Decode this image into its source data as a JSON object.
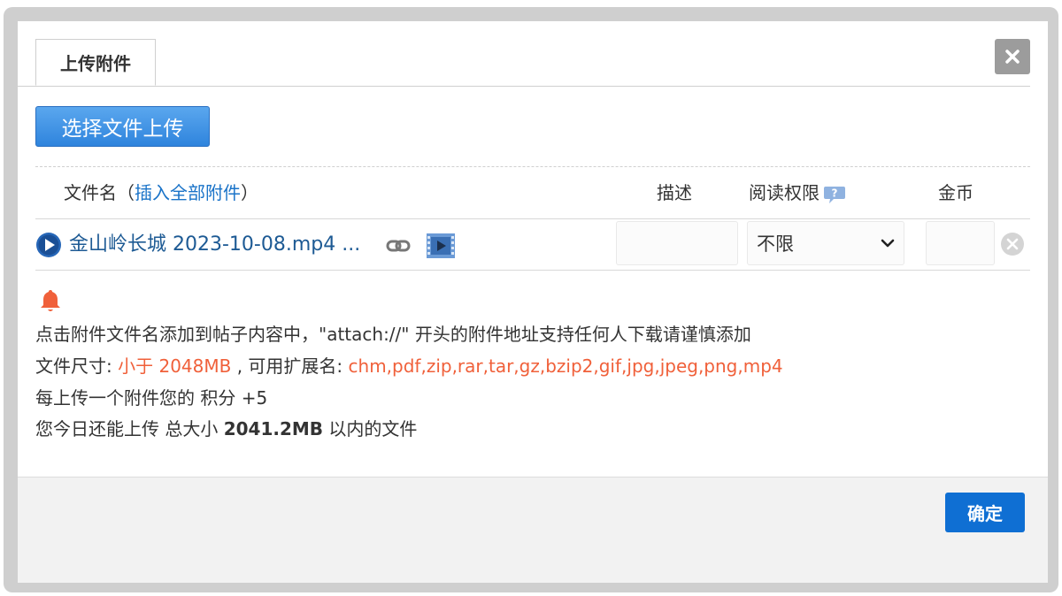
{
  "tab": {
    "label": "上传附件"
  },
  "upload": {
    "label": "选择文件上传"
  },
  "columns": {
    "filename_prefix": "文件名（",
    "insert_all": "插入全部附件",
    "filename_suffix": "）",
    "description": "描述",
    "read_permission": "阅读权限",
    "coins": "金币"
  },
  "file": {
    "name": "金山岭长城 2023-10-08.mp4 ...",
    "permission_value": "不限",
    "description_value": "",
    "coin_value": ""
  },
  "notices": {
    "line1": "点击附件文件名添加到帖子内容中，\"attach://\" 开头的附件地址支持任何人下载请谨慎添加",
    "size_label": "文件尺寸: ",
    "size_value": "小于 2048MB",
    "ext_label": " , 可用扩展名: ",
    "ext_value": "chm,pdf,zip,rar,tar,gz,bzip2,gif,jpg,jpeg,png,mp4",
    "line3": "每上传一个附件您的 积分 +5",
    "line4_prefix": "您今日还能上传 总大小 ",
    "line4_value": "2041.2MB",
    "line4_suffix": " 以内的文件"
  },
  "footer": {
    "confirm_label": "确定"
  },
  "colors": {
    "accent": "#1a73c8",
    "highlight": "#f0603a",
    "confirm": "#0f6fd3",
    "file_link": "#1d5a94"
  },
  "icons": [
    "close-icon",
    "help-icon",
    "play-icon",
    "link-icon",
    "video-icon",
    "remove-icon",
    "bell-icon",
    "chevron-down-icon"
  ]
}
